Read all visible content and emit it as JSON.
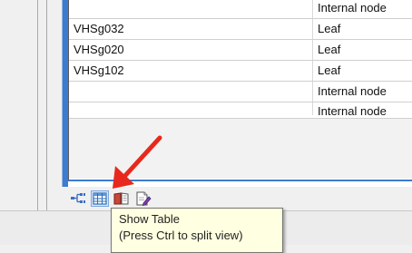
{
  "table": {
    "rows": [
      {
        "name": "",
        "type": "Internal node"
      },
      {
        "name": "VHSg032",
        "type": "Leaf"
      },
      {
        "name": "VHSg020",
        "type": "Leaf"
      },
      {
        "name": "VHSg102",
        "type": "Leaf"
      },
      {
        "name": "",
        "type": "Internal node"
      },
      {
        "name": "",
        "type": "Internal node"
      }
    ]
  },
  "toolbar": {
    "buttons": [
      {
        "icon": "tree-view-icon"
      },
      {
        "icon": "table-view-icon"
      },
      {
        "icon": "book-icon"
      },
      {
        "icon": "document-edit-icon"
      }
    ]
  },
  "tooltip": {
    "title": "Show Table",
    "hint": "(Press Ctrl to split view)"
  },
  "colors": {
    "accent_blue": "#3c7bd0",
    "arrow_red": "#e8281c",
    "tooltip_bg": "#ffffe1"
  }
}
